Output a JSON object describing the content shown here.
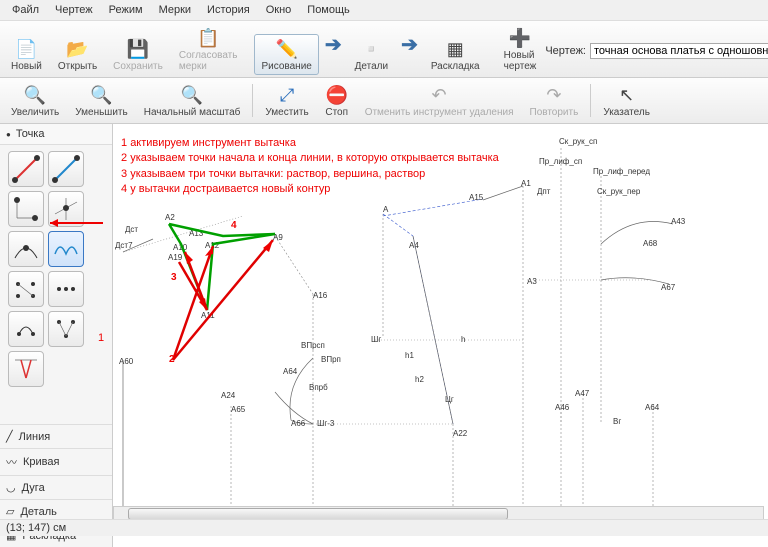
{
  "menu": {
    "items": [
      "Файл",
      "Чертеж",
      "Режим",
      "Мерки",
      "История",
      "Окно",
      "Помощь"
    ]
  },
  "toolbar1": {
    "new": "Новый",
    "open": "Открыть",
    "save": "Сохранить",
    "agree": "Согласовать мерки",
    "draw": "Рисование",
    "details": "Детали",
    "layout": "Раскладка",
    "newdraw": "Новый чертеж",
    "drawing_lbl": "Чертеж:",
    "drawing_val": "точная основа платья с одношовным рука"
  },
  "toolbar2": {
    "zoomin": "Увеличить",
    "zoomout": "Уменьшить",
    "zoomorig": "Начальный масштаб",
    "fit": "Уместить",
    "stop": "Стоп",
    "undo": "Отменить инструмент удаления",
    "redo": "Повторить",
    "pointer": "Указатель"
  },
  "left": {
    "group_point": "Точка",
    "group_line": "Линия",
    "group_curve": "Кривая",
    "group_arc": "Дуга",
    "group_detail": "Деталь",
    "group_layout": "Раскладка",
    "arrow_note": "1"
  },
  "notes": {
    "n1": "активируем инструмент вытачка",
    "n2": "указываем точки начала и конца линии, в которую открывается вытачка",
    "n3": "указываем три точки вытачки: раствор, вершина, раствор",
    "n4": "у вытачки достраивается новый контур"
  },
  "canvas_labels": {
    "Дст": "Дст",
    "Дст7": "Дст7",
    "A2": "А2",
    "A13": "А13",
    "A10": "А10",
    "A19": "А19",
    "A12": "А12",
    "A9": "А9",
    "A11": "А11",
    "num2": "2",
    "num3": "3",
    "num4": "4",
    "A": "А",
    "A15": "А15",
    "A4": "А4",
    "A1": "А1",
    "Дпт": "Дпт",
    "Ск_рук_сп": "Ск_рук_сп",
    "Пр_лиф_сп": "Пр_лиф_сп",
    "Пр_лиф_перед": "Пр_лиф_перед",
    "Ск_рук_пер": "Ск_рук_пер",
    "A43": "А43",
    "A68": "А68",
    "A67": "А67",
    "A3": "А3",
    "A16": "А16",
    "Шг": "Шг",
    "h": "h",
    "h1": "h1",
    "h2": "h2",
    "ВПрсп": "ВПрсп",
    "ВПрп": "ВПрп",
    "Впрб": "Впрб",
    "A64": "А64",
    "A66": "А66",
    "Шг3": "Шг-3",
    "A65": "А65",
    "A24": "А24",
    "Цг": "Цг",
    "A22": "А22",
    "A46": "А46",
    "A47": "А47",
    "Вг": "Вг",
    "A60": "А60"
  },
  "status": "(13; 147) см"
}
